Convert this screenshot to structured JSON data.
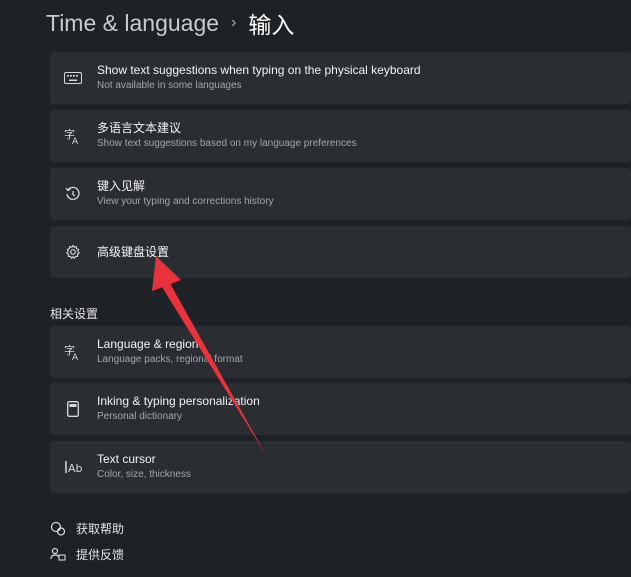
{
  "header": {
    "root": "Time & language",
    "separator": "›",
    "current": "输入"
  },
  "cards": [
    {
      "title": "Show text suggestions when typing on the physical keyboard",
      "subtitle": "Not available in some languages",
      "icon": "keyboard-icon"
    },
    {
      "title": "多语言文本建议",
      "subtitle": "Show text suggestions based on my language preferences",
      "icon": "language-icon"
    },
    {
      "title": "键入见解",
      "subtitle": "View your typing and corrections history",
      "icon": "history-icon"
    },
    {
      "title": "高级键盘设置",
      "subtitle": "",
      "icon": "gear-icon"
    }
  ],
  "related": {
    "label": "相关设置",
    "items": [
      {
        "title": "Language & region",
        "subtitle": "Language packs, regional format",
        "icon": "language-icon"
      },
      {
        "title": "Inking & typing personalization",
        "subtitle": "Personal dictionary",
        "icon": "tablet-icon"
      },
      {
        "title": "Text cursor",
        "subtitle": "Color, size, thickness",
        "icon": "text-cursor-icon"
      }
    ]
  },
  "help": {
    "get_help": "获取帮助",
    "feedback": "提供反馈"
  },
  "colors": {
    "background": "#1e2226",
    "card": "#2a2e32",
    "annotation_arrow": "#e8323c"
  }
}
